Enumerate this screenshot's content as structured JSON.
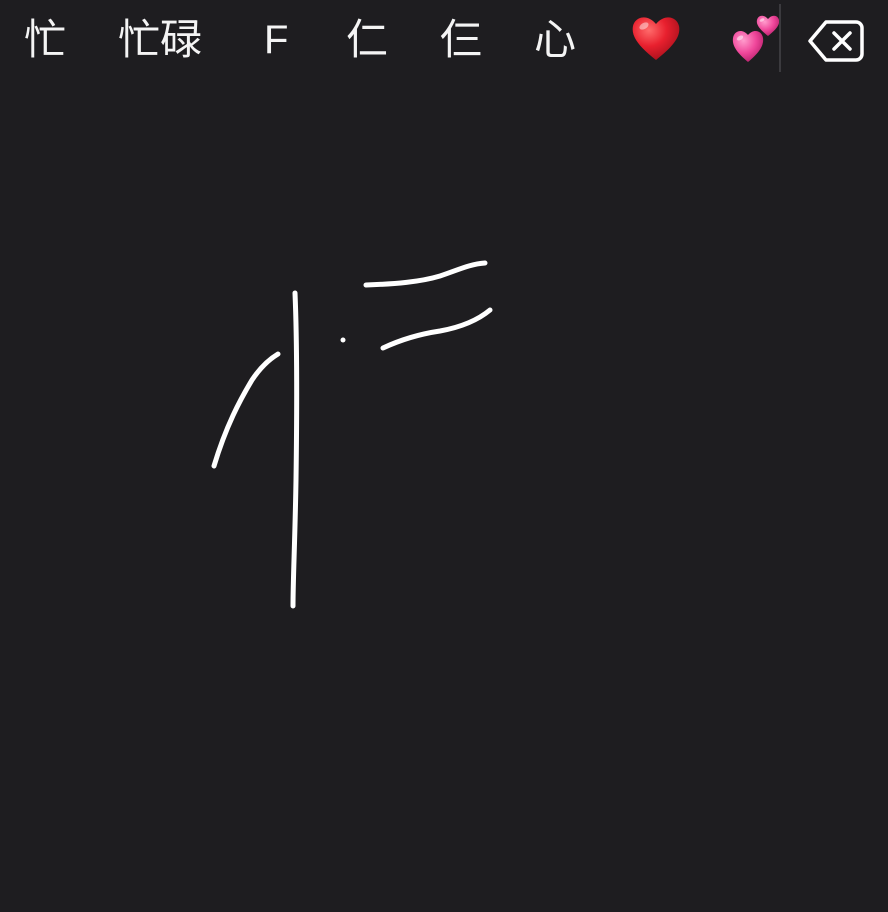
{
  "candidates": [
    {
      "label": "忙",
      "kind": "text"
    },
    {
      "label": "忙碌",
      "kind": "text"
    },
    {
      "label": "F",
      "kind": "text"
    },
    {
      "label": "仁",
      "kind": "text"
    },
    {
      "label": "仨",
      "kind": "text"
    },
    {
      "label": "心",
      "kind": "text"
    },
    {
      "label": "❤️",
      "kind": "emoji",
      "icon": "red-heart-icon"
    },
    {
      "label": "💕",
      "kind": "emoji",
      "icon": "two-hearts-icon"
    }
  ],
  "delete_key": {
    "icon": "backspace-icon"
  },
  "colors": {
    "background": "#1e1d20",
    "text": "#f4f4f4",
    "ink": "#ffffff",
    "heart_red": "#e8202e",
    "heart_pink": "#f0479b"
  },
  "handwriting": {
    "stroke_count": 5
  }
}
